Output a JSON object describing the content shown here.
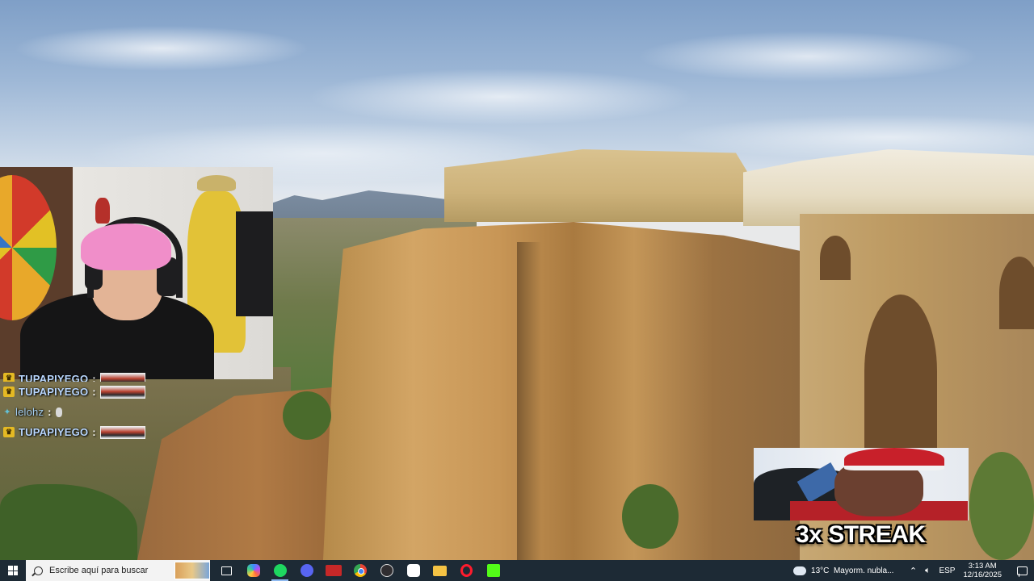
{
  "desktop": {
    "wallpaper": "landscape-photo"
  },
  "webcam": {
    "label": ""
  },
  "chat": {
    "messages": [
      {
        "user": "TUPAPIYEGO",
        "separator": ":",
        "badge": "crown-icon",
        "partial": true
      },
      {
        "user": "TUPAPIYEGO",
        "separator": ":",
        "badge": "crown-icon"
      },
      {
        "user": "lelohz",
        "separator": ":",
        "badge": "sparkle-icon"
      },
      {
        "user": "TUPAPIYEGO",
        "separator": ":",
        "badge": "crown-icon"
      }
    ]
  },
  "streak": {
    "text": "3x STREAK"
  },
  "taskbar": {
    "search_placeholder": "Escribe aquí para buscar",
    "apps": [
      {
        "name": "task-view-icon"
      },
      {
        "name": "copilot-icon"
      },
      {
        "name": "spotify-icon",
        "active": true
      },
      {
        "name": "discord-icon"
      },
      {
        "name": "voicemeeter-icon"
      },
      {
        "name": "chrome-icon"
      },
      {
        "name": "obs-icon"
      },
      {
        "name": "capcut-icon"
      },
      {
        "name": "file-explorer-icon"
      },
      {
        "name": "opera-gx-icon"
      },
      {
        "name": "kick-icon"
      }
    ],
    "tray": {
      "temperature": "13°C",
      "weather": "Mayorm. nubla...",
      "language": "ESP",
      "time": "3:13 AM",
      "date": "12/16/2025"
    }
  },
  "colors": {
    "taskbar_bg": "#1d2a35",
    "chat_name": "#b9d7ff",
    "badge_gold": "#e5b923",
    "streak_text": "#ffffff"
  }
}
